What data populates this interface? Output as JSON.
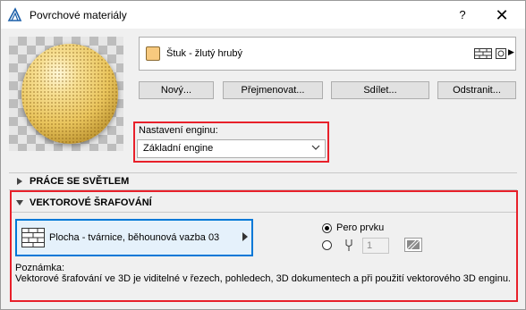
{
  "window": {
    "title": "Povrchové materiály",
    "help": "?",
    "close": "✕"
  },
  "material": {
    "name": "Štuk - žlutý hrubý",
    "swatch_color": "#f7c97e"
  },
  "buttons": {
    "new": "Nový...",
    "rename": "Přejmenovat...",
    "share": "Sdílet...",
    "delete": "Odstranit..."
  },
  "engine": {
    "label": "Nastavení enginu:",
    "value": "Základní engine"
  },
  "sections": {
    "light": "PRÁCE SE SVĚTLEM",
    "vector": "VEKTOROVÉ ŠRAFOVÁNÍ"
  },
  "vector": {
    "fill_label": "Plocha - tvárnice, běhounová vazba 03",
    "pen_option": "Pero prvku",
    "pen_number": "1",
    "note_title": "Poznámka:",
    "note_text": "Vektorové šrafování ve 3D je viditelné v řezech, pohledech, 3D dokumentech a při použití vektorového 3D enginu."
  },
  "colors": {
    "highlight_frame": "#e8202a",
    "accent_blue": "#0078d7"
  }
}
